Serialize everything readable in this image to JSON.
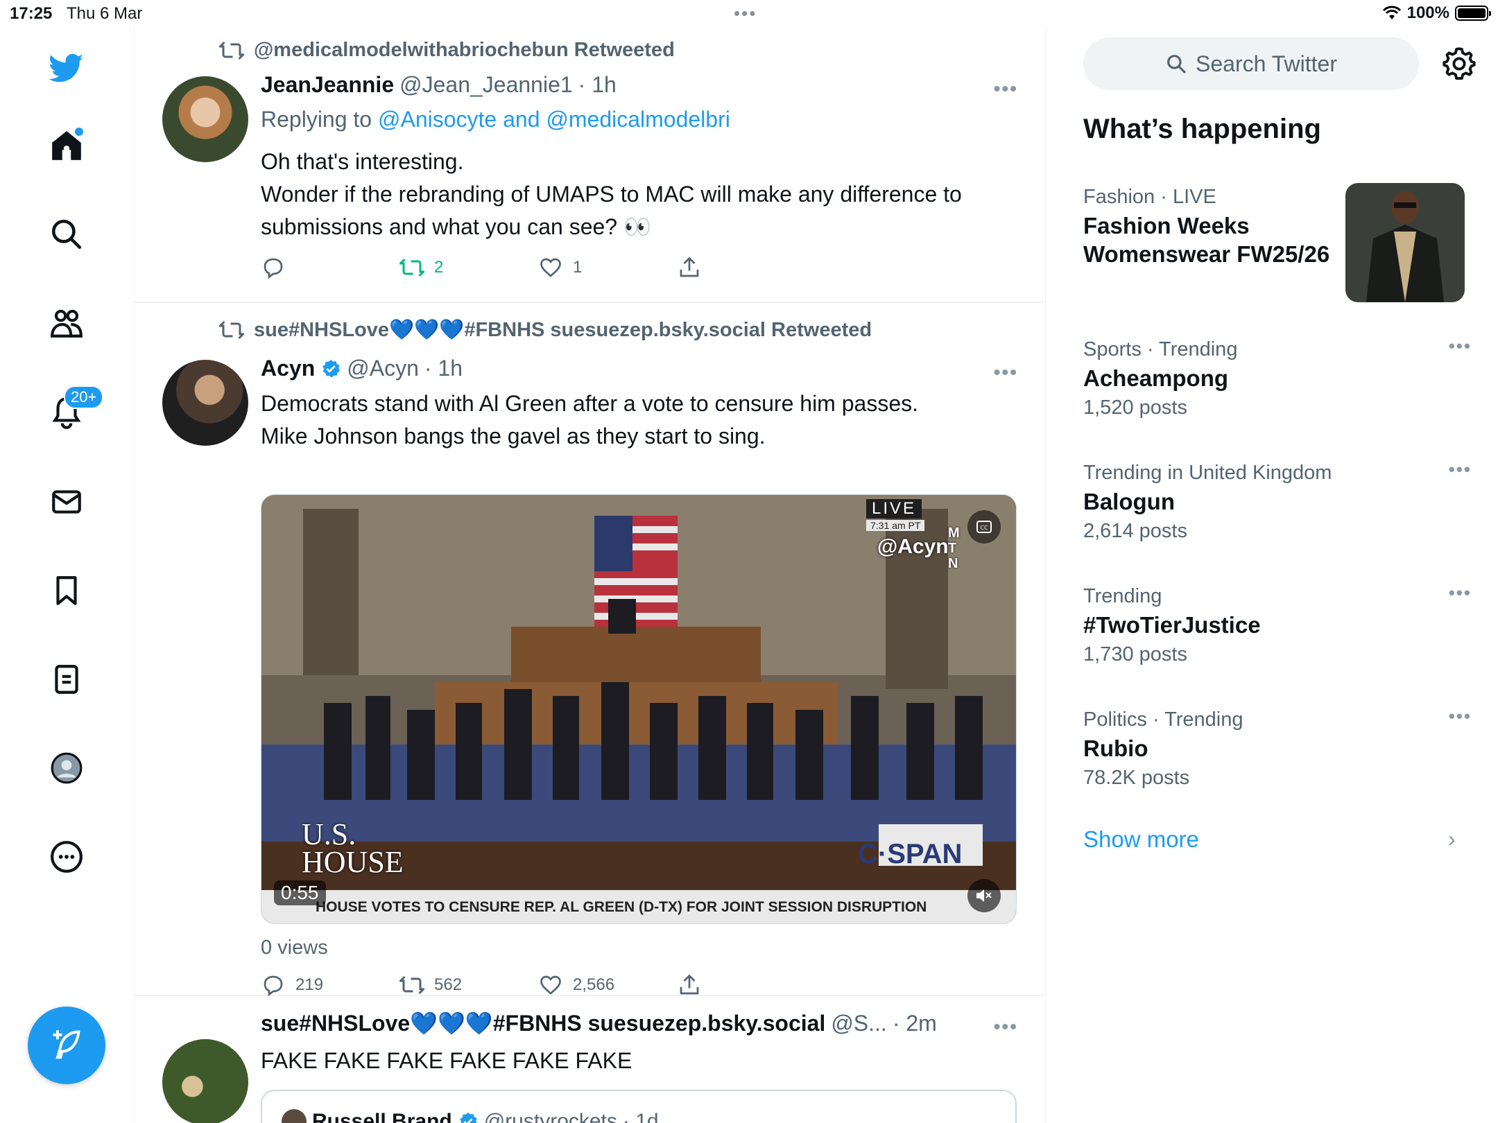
{
  "status_bar": {
    "time": "17:25",
    "date": "Thu 6 Mar",
    "battery": "100%"
  },
  "nav": {
    "notifications_badge": "20+"
  },
  "tweets": [
    {
      "retweeted_by": "@medicalmodelwithabriochebun Retweeted",
      "name": "JeanJeannie",
      "handle": "@Jean_Jeannie1",
      "time": "· 1h",
      "replying_prefix": "Replying to",
      "replying_to": "@Anisocyte and @medicalmodelbri",
      "text_line1": "Oh that's interesting.",
      "text_line2": "Wonder if the rebranding of UMAPS to MAC will make any difference to submissions and what you can see? 👀",
      "retweets": "2",
      "likes": "1"
    },
    {
      "retweeted_by": "sue#NHSLove💙💙💙#FBNHS suesuezep.bsky.social Retweeted",
      "name": "Acyn",
      "handle": "@Acyn",
      "time": "· 1h",
      "text_line1": "Democrats stand with Al Green after a vote to censure him passes.",
      "text_line2": "Mike Johnson bangs the gavel as they start to sing.",
      "video": {
        "duration": "0:55",
        "live": "LIVE",
        "live_time": "7:31 am PT",
        "watermark": "@Acyn",
        "mtn": "MTN",
        "ticker": "HOUSE VOTES TO CENSURE REP. AL GREEN (D-TX) FOR JOINT SESSION DISRUPTION",
        "house_logo_1": "U.S.",
        "house_logo_2": "HOUSE",
        "cspan": "C·SPAN"
      },
      "views": "0 views",
      "replies": "219",
      "retweets": "562",
      "likes": "2,566"
    },
    {
      "name": "sue#NHSLove💙💙💙#FBNHS suesuezep.bsky.social",
      "handle": "@S...",
      "time": "· 2m",
      "text": "FAKE FAKE FAKE FAKE FAKE FAKE",
      "quote_name": "Russell Brand",
      "quote_handle": "@rustyrockets",
      "quote_time": "· 1d"
    }
  ],
  "right": {
    "search_placeholder": "Search Twitter",
    "whats_happening": "What’s happening",
    "trends": [
      {
        "category": "Fashion · LIVE",
        "topic": "Fashion Weeks Womenswear FW25/26",
        "count": ""
      },
      {
        "category": "Sports · Trending",
        "topic": "Acheampong",
        "count": "1,520 posts"
      },
      {
        "category": "Trending in United Kingdom",
        "topic": "Balogun",
        "count": "2,614 posts"
      },
      {
        "category": "Trending",
        "topic": "#TwoTierJustice",
        "count": "1,730 posts"
      },
      {
        "category": "Politics · Trending",
        "topic": "Rubio",
        "count": "78.2K posts"
      }
    ],
    "show_more": "Show more"
  },
  "colors": {
    "accent": "#1d9bf0",
    "retweet_green": "#00ba7c",
    "secondary_text": "#536471"
  }
}
